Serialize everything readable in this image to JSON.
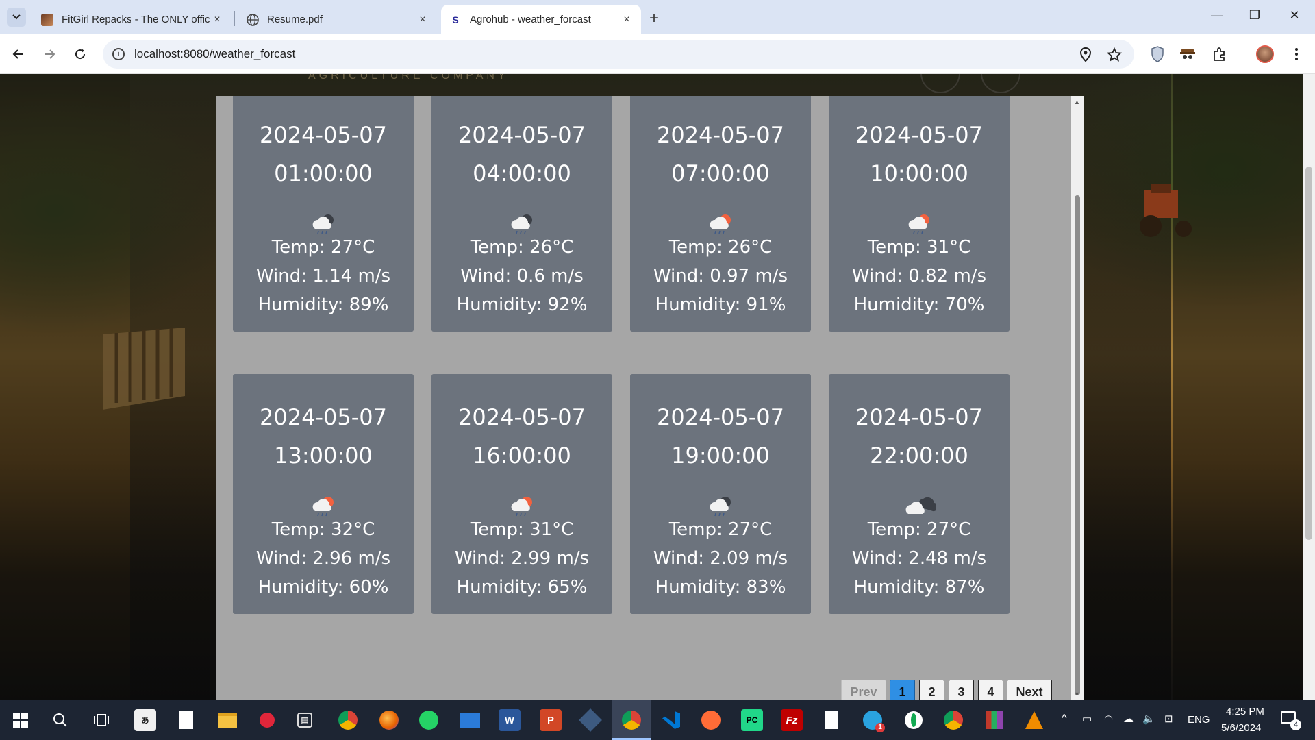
{
  "browser": {
    "tabs": [
      {
        "title": "FitGirl Repacks - The ONLY offic",
        "close": "×",
        "favicon": "fitgirl-favicon"
      },
      {
        "title": "Resume.pdf",
        "close": "×",
        "favicon": "globe-icon"
      },
      {
        "title": "Agrohub - weather_forcast",
        "close": "×",
        "favicon": "agrohub-favicon",
        "favicon_text": "S",
        "active": true
      }
    ],
    "new_tab": "+",
    "window": {
      "minimize": "—",
      "restore": "❐",
      "close": "✕"
    },
    "url": "localhost:8080/weather_forcast",
    "info_glyph": "i"
  },
  "page": {
    "header_ghost": "AGRICULTURE COMPANY",
    "forecasts": [
      {
        "date": "2024-05-07",
        "time": "01:00:00",
        "icon": "night-rain-icon",
        "temp": "Temp: 27°C",
        "wind": "Wind: 1.14 m/s",
        "humidity": "Humidity: 89%"
      },
      {
        "date": "2024-05-07",
        "time": "04:00:00",
        "icon": "night-rain-icon",
        "temp": "Temp: 26°C",
        "wind": "Wind: 0.6 m/s",
        "humidity": "Humidity: 92%"
      },
      {
        "date": "2024-05-07",
        "time": "07:00:00",
        "icon": "day-rain-icon",
        "temp": "Temp: 26°C",
        "wind": "Wind: 0.97 m/s",
        "humidity": "Humidity: 91%"
      },
      {
        "date": "2024-05-07",
        "time": "10:00:00",
        "icon": "day-rain-icon",
        "temp": "Temp: 31°C",
        "wind": "Wind: 0.82 m/s",
        "humidity": "Humidity: 70%"
      },
      {
        "date": "2024-05-07",
        "time": "13:00:00",
        "icon": "day-rain-icon",
        "temp": "Temp: 32°C",
        "wind": "Wind: 2.96 m/s",
        "humidity": "Humidity: 60%"
      },
      {
        "date": "2024-05-07",
        "time": "16:00:00",
        "icon": "day-rain-icon",
        "temp": "Temp: 31°C",
        "wind": "Wind: 2.99 m/s",
        "humidity": "Humidity: 65%"
      },
      {
        "date": "2024-05-07",
        "time": "19:00:00",
        "icon": "night-rain-icon",
        "temp": "Temp: 27°C",
        "wind": "Wind: 2.09 m/s",
        "humidity": "Humidity: 83%"
      },
      {
        "date": "2024-05-07",
        "time": "22:00:00",
        "icon": "night-cloud-icon",
        "temp": "Temp: 27°C",
        "wind": "Wind: 2.48 m/s",
        "humidity": "Humidity: 87%"
      }
    ],
    "pagination": {
      "prev": "Prev",
      "pages": [
        "1",
        "2",
        "3",
        "4"
      ],
      "current": "1",
      "next": "Next"
    }
  },
  "taskbar": {
    "lang": "ENG",
    "time": "4:25 PM",
    "date": "5/6/2024",
    "notification_count": "4",
    "telegram_badge": "1"
  },
  "colors": {
    "card": "#6c737d",
    "panel": "#a6a6a6",
    "active_page": "#2f8fe4"
  }
}
